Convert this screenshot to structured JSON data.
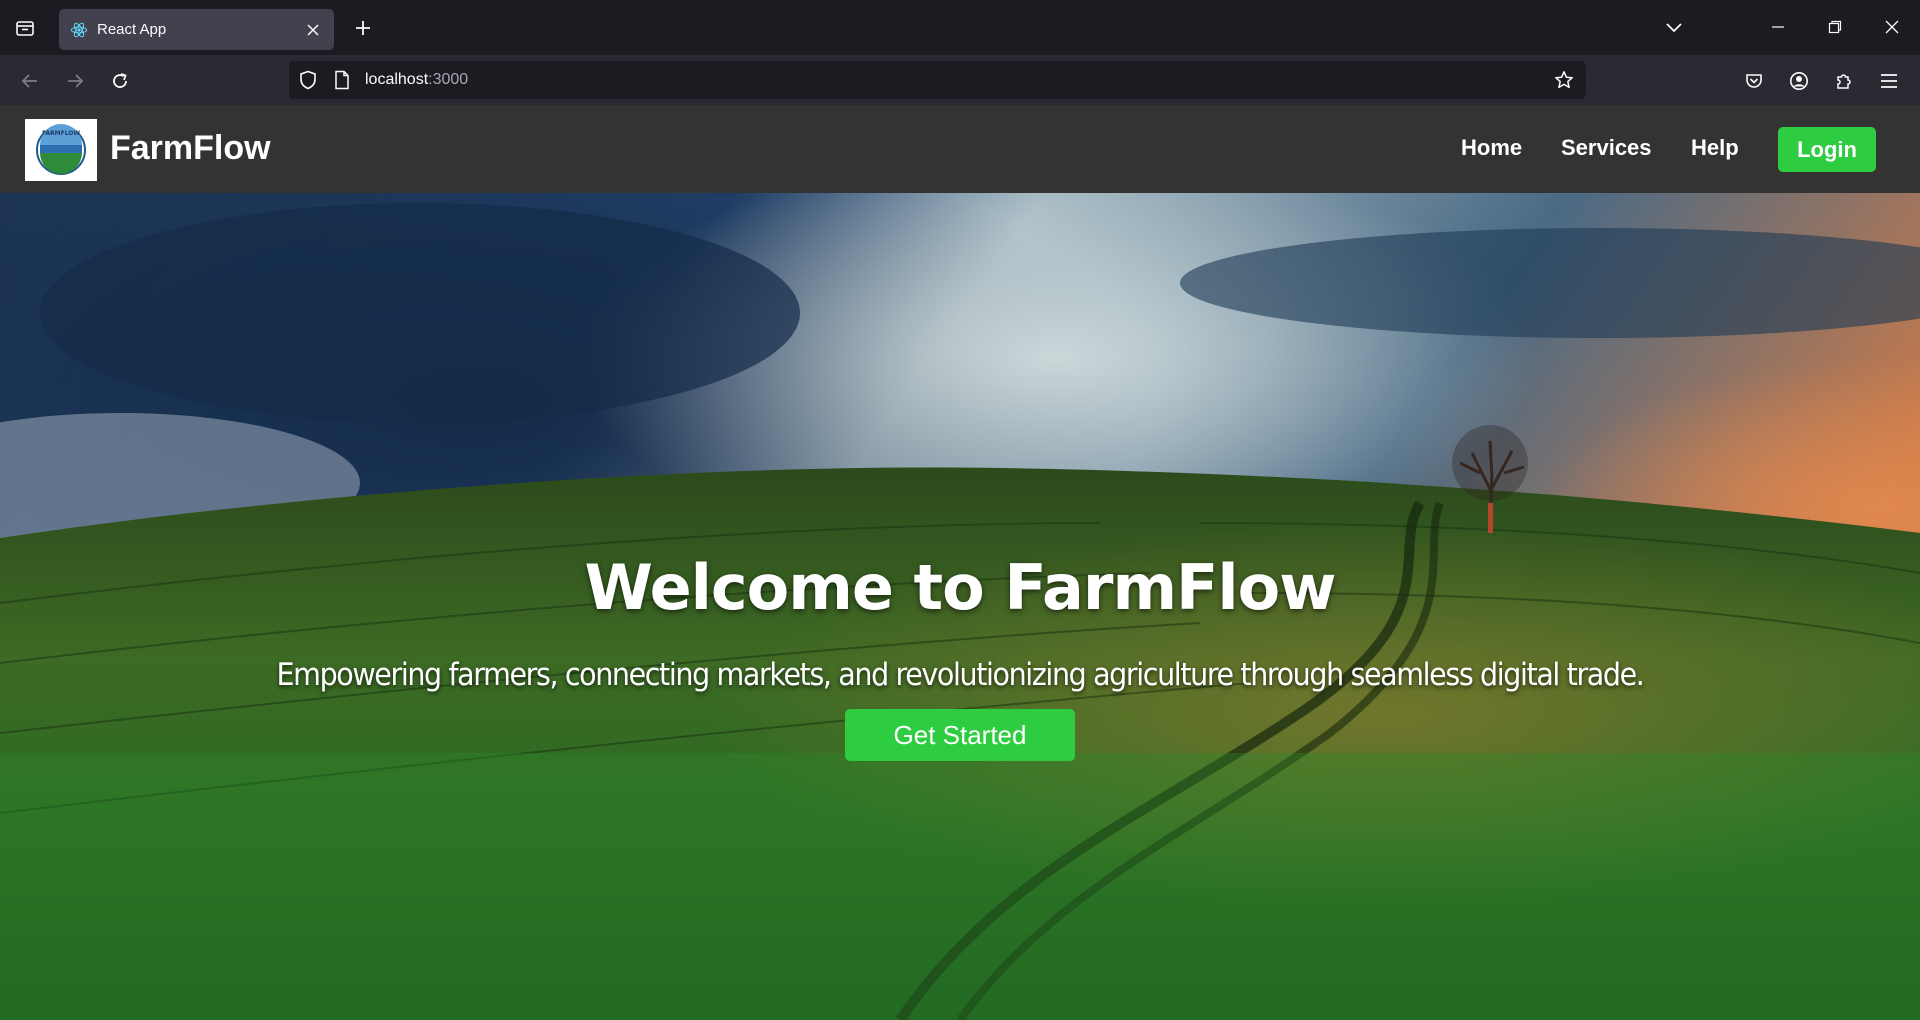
{
  "browser": {
    "tab_title": "React App",
    "url_host": "localhost",
    "url_port": ":3000"
  },
  "site": {
    "brand": "FarmFlow",
    "nav": {
      "home": "Home",
      "services": "Services",
      "help": "Help",
      "login": "Login"
    },
    "colors": {
      "accent": "#2ecc40",
      "header_bg": "#333333"
    }
  },
  "hero": {
    "title": "Welcome to FarmFlow",
    "subtitle": "Empowering farmers, connecting markets, and revolutionizing agriculture through seamless digital trade.",
    "cta": "Get Started"
  }
}
